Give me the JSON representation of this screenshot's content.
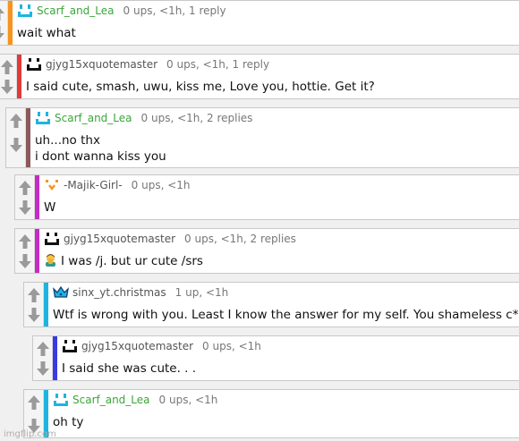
{
  "colors": {
    "orange": "#f7941d",
    "red": "#e03a3a",
    "brown": "#8b5a5a",
    "magenta": "#c42cc4",
    "cyan": "#1eb4e0",
    "blue": "#3a3ae0",
    "username_green": "#3aa63a"
  },
  "comments": [
    {
      "user": "Scarf_and_Lea",
      "meta": "0 ups, <1h, 1 reply",
      "lines": [
        "wait what"
      ],
      "avatar": "cyan-face-icon",
      "stripe": "orange"
    },
    {
      "user": "gjyg15xquotemaster",
      "meta": "0 ups, <1h, 1 reply",
      "lines": [
        "I said cute, smash, uwu, kiss me, Love you, hottie. Get it?"
      ],
      "avatar": "black-face-icon",
      "stripe": "red"
    },
    {
      "user": "Scarf_and_Lea",
      "meta": "0 ups, <1h, 2 replies",
      "lines": [
        "uh...no thx",
        "i dont wanna kiss you"
      ],
      "avatar": "cyan-face-icon",
      "stripe": "brown"
    },
    {
      "user": "-Majik-Girl-",
      "meta": "0 ups, <1h",
      "lines": [
        "W"
      ],
      "avatar": "orange-face-icon",
      "stripe": "magenta"
    },
    {
      "user": "gjyg15xquotemaster",
      "meta": "0 ups, <1h, 2 replies",
      "lines": [
        "I was /j. but ur cute /srs"
      ],
      "avatar": "black-face-icon",
      "stripe": "magenta",
      "emoji": "person-facepalming-emoji"
    },
    {
      "user": "sinx_yt.christmas",
      "meta": "1 up, <1h",
      "lines": [
        "Wtf is wrong with you. Least I know the answer for my self. You shameless c**t"
      ],
      "avatar": "crown-icon",
      "stripe": "cyan"
    },
    {
      "user": "gjyg15xquotemaster",
      "meta": "0 ups, <1h",
      "lines": [
        "I said she was cute. . ."
      ],
      "avatar": "black-face-icon",
      "stripe": "blue"
    },
    {
      "user": "Scarf_and_Lea",
      "meta": "0 ups, <1h",
      "lines": [
        "oh ty"
      ],
      "avatar": "cyan-face-icon",
      "stripe": "cyan"
    }
  ],
  "watermark": "imgflip.com"
}
